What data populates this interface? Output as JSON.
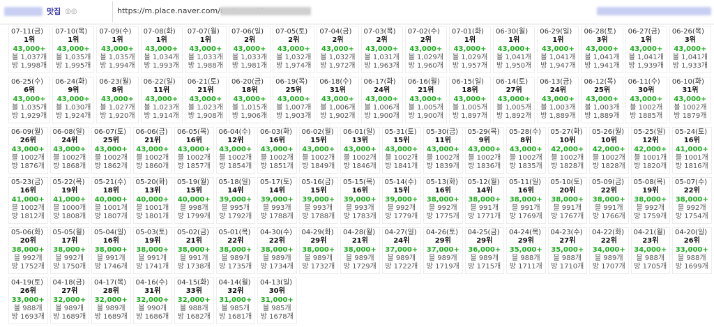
{
  "header": {
    "title_suffix": "맛집",
    "title_tail": "◎◎",
    "url": "https://m.place.naver.com/restaurant/"
  },
  "rows": [
    [
      {
        "date": "07-11(금)",
        "rank": "1위",
        "price": "43,000+",
        "blog": "블 1,037개",
        "visit": "방 1,998개"
      },
      {
        "date": "07-10(목)",
        "rank": "1위",
        "price": "43,000+",
        "blog": "블 1,035개",
        "visit": "방 1,995개"
      },
      {
        "date": "07-09(수)",
        "rank": "1위",
        "price": "43,000+",
        "blog": "블 1,035개",
        "visit": "방 1,994개"
      },
      {
        "date": "07-08(화)",
        "rank": "1위",
        "price": "43,000+",
        "blog": "블 1,034개",
        "visit": "방 1,993개"
      },
      {
        "date": "07-07(월)",
        "rank": "1위",
        "price": "43,000+",
        "blog": "블 1,033개",
        "visit": "방 1,988개"
      },
      {
        "date": "07-06(일)",
        "rank": "2위",
        "price": "43,000+",
        "blog": "블 1,033개",
        "visit": "방 1,981개"
      },
      {
        "date": "07-05(토)",
        "rank": "2위",
        "price": "43,000+",
        "blog": "블 1,032개",
        "visit": "방 1,974개"
      },
      {
        "date": "07-04(금)",
        "rank": "2위",
        "price": "43,000+",
        "blog": "블 1,032개",
        "visit": "방 1,972개"
      },
      {
        "date": "07-03(목)",
        "rank": "2위",
        "price": "43,000+",
        "blog": "블 1,031개",
        "visit": "방 1,963개"
      },
      {
        "date": "07-02(수)",
        "rank": "2위",
        "price": "43,000+",
        "blog": "블 1,029개",
        "visit": "방 1,960개"
      },
      {
        "date": "07-01(화)",
        "rank": "1위",
        "price": "43,000+",
        "blog": "블 1,029개",
        "visit": "방 1,957개"
      },
      {
        "date": "06-30(월)",
        "rank": "1위",
        "price": "43,000+",
        "blog": "블 1,041개",
        "visit": "방 1,950개"
      },
      {
        "date": "06-29(일)",
        "rank": "1위",
        "price": "43,000+",
        "blog": "블 1,041개",
        "visit": "방 1,947개"
      },
      {
        "date": "06-28(토)",
        "rank": "3위",
        "price": "43,000+",
        "blog": "블 1,041개",
        "visit": "방 1,941개"
      },
      {
        "date": "06-27(금)",
        "rank": "1위",
        "price": "43,000+",
        "blog": "블 1,041개",
        "visit": "방 1,939개"
      },
      {
        "date": "06-26(목)",
        "rank": "3위",
        "price": "43,000+",
        "blog": "블 1,041개",
        "visit": "방 1,933개"
      }
    ],
    [
      {
        "date": "06-25(수)",
        "rank": "6위",
        "price": "43,000+",
        "blog": "블 1,035개",
        "visit": "방 1,929개"
      },
      {
        "date": "06-24(화)",
        "rank": "9위",
        "price": "43,000+",
        "blog": "블 1,030개",
        "visit": "방 1,924개"
      },
      {
        "date": "06-23(월)",
        "rank": "8위",
        "price": "43,000+",
        "blog": "블 1,027개",
        "visit": "방 1,920개"
      },
      {
        "date": "06-22(일)",
        "rank": "11위",
        "price": "43,000+",
        "blog": "블 1,023개",
        "visit": "방 1,914개"
      },
      {
        "date": "06-21(토)",
        "rank": "21위",
        "price": "43,000+",
        "blog": "블 1,023개",
        "visit": "방 1,908개"
      },
      {
        "date": "06-20(금)",
        "rank": "18위",
        "price": "43,000+",
        "blog": "블 1,015개",
        "visit": "방 1,906개"
      },
      {
        "date": "06-19(목)",
        "rank": "25위",
        "price": "43,000+",
        "blog": "블 1,007개",
        "visit": "방 1,903개"
      },
      {
        "date": "06-18(수)",
        "rank": "31위",
        "price": "43,000+",
        "blog": "블 1,006개",
        "visit": "방 1,902개"
      },
      {
        "date": "06-17(화)",
        "rank": "24위",
        "price": "43,000+",
        "blog": "블 1,006개",
        "visit": "방 1,900개"
      },
      {
        "date": "06-16(월)",
        "rank": "21위",
        "price": "43,000+",
        "blog": "블 1,005개",
        "visit": "방 1,900개"
      },
      {
        "date": "06-15(일)",
        "rank": "18위",
        "price": "43,000+",
        "blog": "블 1,005개",
        "visit": "방 1,897개"
      },
      {
        "date": "06-14(토)",
        "rank": "27위",
        "price": "43,000+",
        "blog": "블 1,005개",
        "visit": "방 1,892개"
      },
      {
        "date": "06-13(금)",
        "rank": "24위",
        "price": "43,000+",
        "blog": "블 1,003개",
        "visit": "방 1,889개"
      },
      {
        "date": "06-12(목)",
        "rank": "25위",
        "price": "43,000+",
        "blog": "블 1,003개",
        "visit": "방 1,889개"
      },
      {
        "date": "06-11(수)",
        "rank": "30위",
        "price": "43,000+",
        "blog": "블 1002개",
        "visit": "방 1885개"
      },
      {
        "date": "06-10(화)",
        "rank": "31위",
        "price": "43,000+",
        "blog": "블 1002개",
        "visit": "방 1879개"
      }
    ],
    [
      {
        "date": "06-09(월)",
        "rank": "26위",
        "price": "43,000+",
        "blog": "블 1002개",
        "visit": "방 1876개"
      },
      {
        "date": "06-08(일)",
        "rank": "24위",
        "price": "43,000+",
        "blog": "블 1002개",
        "visit": "방 1868개"
      },
      {
        "date": "06-07(토)",
        "rank": "25위",
        "price": "43,000+",
        "blog": "블 1002개",
        "visit": "방 1862개"
      },
      {
        "date": "06-06(금)",
        "rank": "21위",
        "price": "43,000+",
        "blog": "블 1002개",
        "visit": "방 1860개"
      },
      {
        "date": "06-05(목)",
        "rank": "16위",
        "price": "43,000+",
        "blog": "블 1002개",
        "visit": "방 1857개"
      },
      {
        "date": "06-04(수)",
        "rank": "12위",
        "price": "43,000+",
        "blog": "블 1002개",
        "visit": "방 1854개"
      },
      {
        "date": "06-03(화)",
        "rank": "16위",
        "price": "43,000+",
        "blog": "블 1002개",
        "visit": "방 1851개"
      },
      {
        "date": "06-02(월)",
        "rank": "15위",
        "price": "43,000+",
        "blog": "블 1002개",
        "visit": "방 1849개"
      },
      {
        "date": "06-01(일)",
        "rank": "13위",
        "price": "43,000+",
        "blog": "블 1002개",
        "visit": "방 1846개"
      },
      {
        "date": "05-31(토)",
        "rank": "15위",
        "price": "43,000+",
        "blog": "블 1002개",
        "visit": "방 1841개"
      },
      {
        "date": "05-30(금)",
        "rank": "11위",
        "price": "43,000+",
        "blog": "블 1002개",
        "visit": "방 1839개"
      },
      {
        "date": "05-29(목)",
        "rank": "9위",
        "price": "43,000+",
        "blog": "블 1002개",
        "visit": "방 1836개"
      },
      {
        "date": "05-28(수)",
        "rank": "8위",
        "price": "43,000+",
        "blog": "블 1002개",
        "visit": "방 1835개"
      },
      {
        "date": "05-27(화)",
        "rank": "10위",
        "price": "42,000+",
        "blog": "블 1002개",
        "visit": "방 1828개"
      },
      {
        "date": "05-26(월)",
        "rank": "10위",
        "price": "42,000+",
        "blog": "블 1002개",
        "visit": "방 1828개"
      },
      {
        "date": "05-25(일)",
        "rank": "12위",
        "price": "42,000+",
        "blog": "블 1001개",
        "visit": "방 1820개"
      },
      {
        "date": "05-24(토)",
        "rank": "16위",
        "price": "41,000+",
        "blog": "블 1001개",
        "visit": "방 1816개"
      }
    ],
    [
      {
        "date": "05-23(금)",
        "rank": "16위",
        "price": "41,000+",
        "blog": "블 1002개",
        "visit": "방 1812개"
      },
      {
        "date": "05-22(목)",
        "rank": "19위",
        "price": "41,000+",
        "blog": "블 1000개",
        "visit": "방 1808개"
      },
      {
        "date": "05-21(수)",
        "rank": "18위",
        "price": "40,000+",
        "blog": "블 1001개",
        "visit": "방 1807개"
      },
      {
        "date": "05-20(화)",
        "rank": "13위",
        "price": "40,000+",
        "blog": "블 1001개",
        "visit": "방 1801개"
      },
      {
        "date": "05-19(월)",
        "rank": "15위",
        "price": "40,000+",
        "blog": "블 998개",
        "visit": "방 1799개"
      },
      {
        "date": "05-18(일)",
        "rank": "14위",
        "price": "39,000+",
        "blog": "블 995개",
        "visit": "방 1792개"
      },
      {
        "date": "05-17(토)",
        "rank": "14위",
        "price": "39,000+",
        "blog": "블 993개",
        "visit": "방 1788개"
      },
      {
        "date": "05-16(금)",
        "rank": "15위",
        "price": "39,000+",
        "blog": "블 993개",
        "visit": "방 1788개"
      },
      {
        "date": "05-15(목)",
        "rank": "16위",
        "price": "39,000+",
        "blog": "블 993개",
        "visit": "방 1783개"
      },
      {
        "date": "05-14(수)",
        "rank": "15위",
        "price": "39,000+",
        "blog": "블 992개",
        "visit": "방 1779개"
      },
      {
        "date": "05-13(화)",
        "rank": "16위",
        "price": "38,000+",
        "blog": "블 992개",
        "visit": "방 1775개"
      },
      {
        "date": "05-12(월)",
        "rank": "14위",
        "price": "38,000+",
        "blog": "블 991개",
        "visit": "방 1771개"
      },
      {
        "date": "05-11(일)",
        "rank": "16위",
        "price": "38,000+",
        "blog": "블 991개",
        "visit": "방 1769개"
      },
      {
        "date": "05-10(토)",
        "rank": "20위",
        "price": "38,000+",
        "blog": "블 991개",
        "visit": "방 1767개"
      },
      {
        "date": "05-09(금)",
        "rank": "22위",
        "price": "38,000+",
        "blog": "블 991개",
        "visit": "방 1766개"
      },
      {
        "date": "05-08(목)",
        "rank": "19위",
        "price": "38,000+",
        "blog": "블 992개",
        "visit": "방 1759개"
      },
      {
        "date": "05-07(수)",
        "rank": "22위",
        "price": "38,000+",
        "blog": "블 992개",
        "visit": "방 1754개"
      }
    ],
    [
      {
        "date": "05-06(화)",
        "rank": "20위",
        "price": "38,000+",
        "blog": "블 992개",
        "visit": "방 1752개"
      },
      {
        "date": "05-05(월)",
        "rank": "17위",
        "price": "38,000+",
        "blog": "블 992개",
        "visit": "방 1750개"
      },
      {
        "date": "05-04(일)",
        "rank": "16위",
        "price": "38,000+",
        "blog": "블 991개",
        "visit": "방 1746개"
      },
      {
        "date": "05-03(토)",
        "rank": "19위",
        "price": "38,000+",
        "blog": "블 991개",
        "visit": "방 1741개"
      },
      {
        "date": "05-02(금)",
        "rank": "21위",
        "price": "38,000+",
        "blog": "블 991개",
        "visit": "방 1738개"
      },
      {
        "date": "05-01(목)",
        "rank": "22위",
        "price": "38,000+",
        "blog": "블 989개",
        "visit": "방 1735개"
      },
      {
        "date": "04-30(수)",
        "rank": "22위",
        "price": "38,000+",
        "blog": "블 989개",
        "visit": "방 1734개"
      },
      {
        "date": "04-29(화)",
        "rank": "29위",
        "price": "38,000+",
        "blog": "블 989개",
        "visit": "방 1732개"
      },
      {
        "date": "04-28(월)",
        "rank": "21위",
        "price": "38,000+",
        "blog": "블 989개",
        "visit": "방 1729개"
      },
      {
        "date": "04-27(일)",
        "rank": "24위",
        "price": "37,000+",
        "blog": "블 989개",
        "visit": "방 1722개"
      },
      {
        "date": "04-26(토)",
        "rank": "29위",
        "price": "37,000+",
        "blog": "블 989개",
        "visit": "방 1719개"
      },
      {
        "date": "04-25(금)",
        "rank": "29위",
        "price": "36,000+",
        "blog": "블 989개",
        "visit": "방 1715개"
      },
      {
        "date": "04-24(목)",
        "rank": "29위",
        "price": "35,000+",
        "blog": "블 988개",
        "visit": "방 1711개"
      },
      {
        "date": "04-23(수)",
        "rank": "27위",
        "price": "35,000+",
        "blog": "블 988개",
        "visit": "방 1710개"
      },
      {
        "date": "04-22(화)",
        "rank": "22위",
        "price": "34,000+",
        "blog": "블 989개",
        "visit": "방 1707개"
      },
      {
        "date": "04-21(월)",
        "rank": "23위",
        "price": "34,000+",
        "blog": "블 988개",
        "visit": "방 1705개"
      },
      {
        "date": "04-20(일)",
        "rank": "26위",
        "price": "33,000+",
        "blog": "블 988개",
        "visit": "방 1699개"
      }
    ],
    [
      {
        "date": "04-19(토)",
        "rank": "26위",
        "price": "33,000+",
        "blog": "블 988개",
        "visit": "방 1693개"
      },
      {
        "date": "04-18(금)",
        "rank": "27위",
        "price": "32,000+",
        "blog": "블 989개",
        "visit": "방 1689개"
      },
      {
        "date": "04-17(목)",
        "rank": "28위",
        "price": "32,000+",
        "blog": "블 989개",
        "visit": "방 1689개"
      },
      {
        "date": "04-16(수)",
        "rank": "31위",
        "price": "32,000+",
        "blog": "블 990개",
        "visit": "방 1686개"
      },
      {
        "date": "04-15(화)",
        "rank": "33위",
        "price": "32,000+",
        "blog": "블 988개",
        "visit": "방 1682개"
      },
      {
        "date": "04-14(월)",
        "rank": "32위",
        "price": "31,000+",
        "blog": "블 985개",
        "visit": "방 1681개"
      },
      {
        "date": "04-13(일)",
        "rank": "30위",
        "price": "31,000+",
        "blog": "블 985개",
        "visit": "방 1678개"
      }
    ]
  ]
}
